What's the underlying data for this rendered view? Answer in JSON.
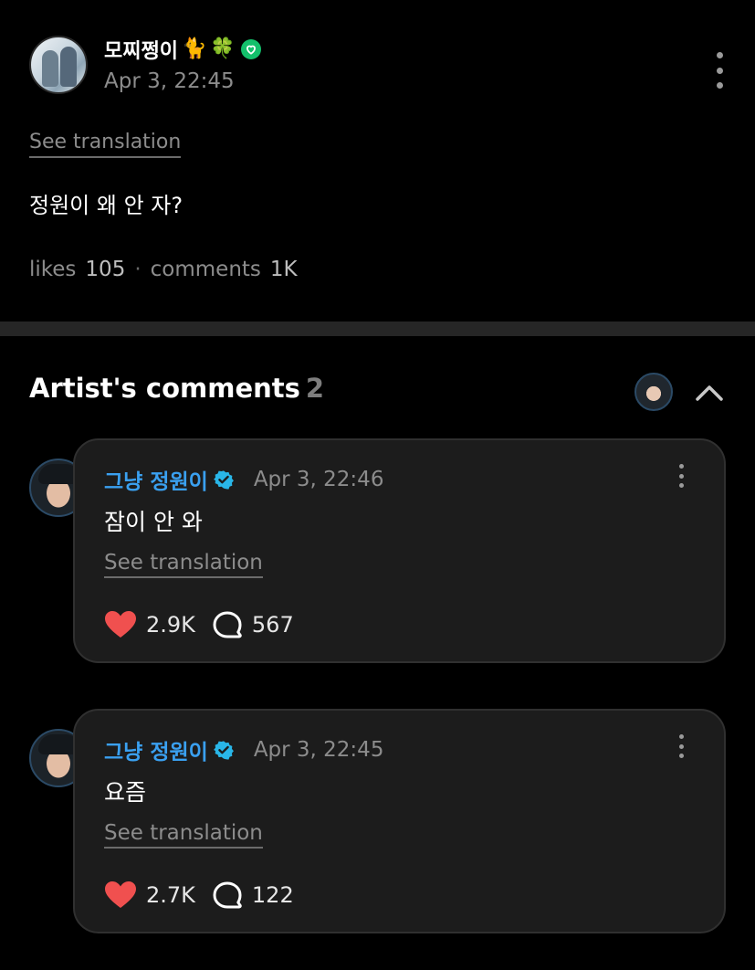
{
  "post": {
    "author_name": "모찌쩡이",
    "author_emojis": [
      "🐈",
      "🍀"
    ],
    "time": "Apr 3, 22:45",
    "see_translation": "See translation",
    "body": "정원이 왜 안 자?",
    "likes_label": "likes",
    "likes_count": "105",
    "separator": "·",
    "comments_label": "comments",
    "comments_count": "1K"
  },
  "artist_comments": {
    "title": "Artist's comments",
    "count": "2",
    "items": [
      {
        "name": "그냥 정원이",
        "time": "Apr 3, 22:46",
        "text": "잠이 안 와",
        "see_translation": "See translation",
        "likes": "2.9K",
        "replies": "567"
      },
      {
        "name": "그냥 정원이",
        "time": "Apr 3, 22:45",
        "text": "요즘",
        "see_translation": "See translation",
        "likes": "2.7K",
        "replies": "122"
      }
    ]
  },
  "colors": {
    "background": "#000000",
    "card": "#1c1c1c",
    "artist_name": "#3aa0f0",
    "verified": "#29b6e8",
    "like_heart": "#f0504f",
    "badge": "#13c06b",
    "muted_text": "#8c8c8c"
  },
  "icons": {
    "badge": "heart-badge-icon",
    "post_more": "more-vert-icon",
    "collapse": "chevron-up-icon",
    "verified": "verified-check-icon",
    "like": "heart-icon",
    "reply": "speech-bubble-icon"
  }
}
